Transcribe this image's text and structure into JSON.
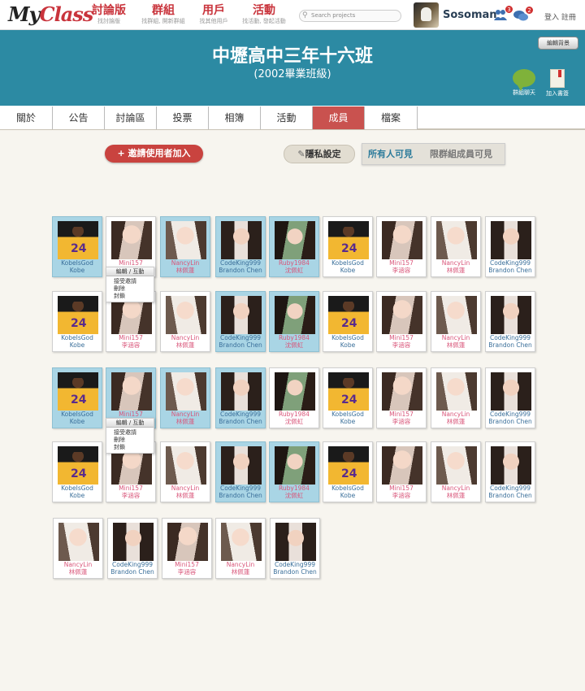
{
  "brand": {
    "logo_my": "My",
    "logo_class": "Class"
  },
  "topnav": [
    {
      "label": "討論版",
      "sub": "找討論版"
    },
    {
      "label": "群組",
      "sub": "找群組, 開新群組"
    },
    {
      "label": "用戶",
      "sub": "找其他用戶"
    },
    {
      "label": "活動",
      "sub": "找活動, 發起活動"
    }
  ],
  "search": {
    "placeholder": "Search projects"
  },
  "user": {
    "name": "Sosoman",
    "friends_badge": "3",
    "chat_badge": "2"
  },
  "auth": {
    "login": "登入",
    "register": "註冊"
  },
  "banner": {
    "title": "中壢高中三年十六班",
    "subtitle": "(2002畢業班級)",
    "edit_bg": "編輯背景",
    "chat_label": "群組聊天",
    "bookmark_label": "加入書簽"
  },
  "tabs": [
    "關於",
    "公告",
    "討論區",
    "投票",
    "相簿",
    "活動",
    "成員",
    "檔案"
  ],
  "active_tab": "成員",
  "actions": {
    "invite": "+ 邀請使用者加入",
    "privacy": "隱私設定",
    "visibility_all": "所有人可見",
    "visibility_group": "限群組成員可見"
  },
  "member_menu": {
    "head": "編輯 / 互動",
    "items": [
      "接受邀請",
      "刪除",
      "封鎖"
    ]
  },
  "members": {
    "kobe": {
      "line1": "KobeIsGod",
      "line2": "Kobe"
    },
    "mini": {
      "line1": "Mini157",
      "line2": "李涵容"
    },
    "nancy": {
      "line1": "NancyLin",
      "line2": "林佩蓮"
    },
    "code": {
      "line1": "CodeKing999",
      "line2": "Brandon Chen"
    },
    "ruby": {
      "line1": "Ruby1984",
      "line2": "沈佩虹"
    }
  },
  "colors": {
    "accent": "#c9433f",
    "banner": "#2c8aa3",
    "highlight": "#a9d5e5"
  }
}
